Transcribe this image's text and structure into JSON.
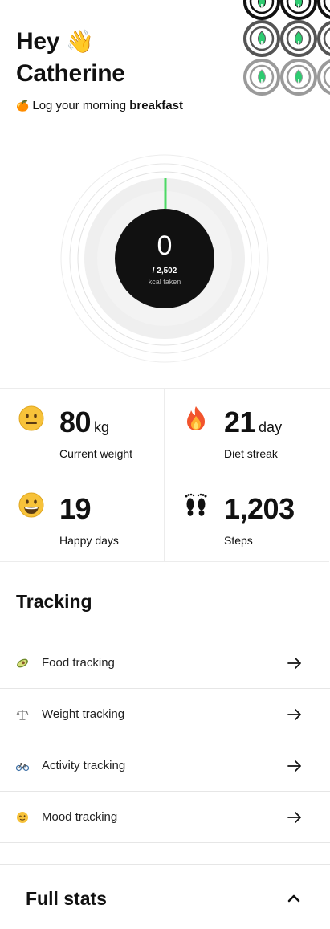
{
  "header": {
    "greeting": "Hey",
    "name": "Catherine",
    "wave_emoji": "👋",
    "prompt_emoji": "🍊",
    "prompt_text": "Log your morning",
    "prompt_meal": "breakfast"
  },
  "calorie_gauge": {
    "taken": "0",
    "goal": "/ 2,502",
    "unit_label": "kcal taken",
    "progress_fraction": 0,
    "accent_color": "#4cd964"
  },
  "stats": [
    {
      "icon": "neutral-face-emoji",
      "value": "80",
      "unit": "kg",
      "label": "Current weight"
    },
    {
      "icon": "fire-emoji",
      "value": "21",
      "unit": "day",
      "label": "Diet streak"
    },
    {
      "icon": "grinning-face-emoji",
      "value": "19",
      "unit": "",
      "label": "Happy days"
    },
    {
      "icon": "footprints-emoji",
      "value": "1,203",
      "unit": "",
      "label": "Steps"
    }
  ],
  "tracking": {
    "title": "Tracking",
    "items": [
      {
        "icon": "avocado-icon",
        "label": "Food tracking"
      },
      {
        "icon": "scale-icon",
        "label": "Weight tracking"
      },
      {
        "icon": "bicycle-icon",
        "label": "Activity tracking"
      },
      {
        "icon": "wink-face-icon",
        "label": "Mood tracking"
      }
    ]
  },
  "full_stats": {
    "title": "Full stats",
    "expanded": true
  },
  "colors": {
    "brand_green": "#2ecc71",
    "text": "#111111",
    "divider": "#ececec"
  }
}
